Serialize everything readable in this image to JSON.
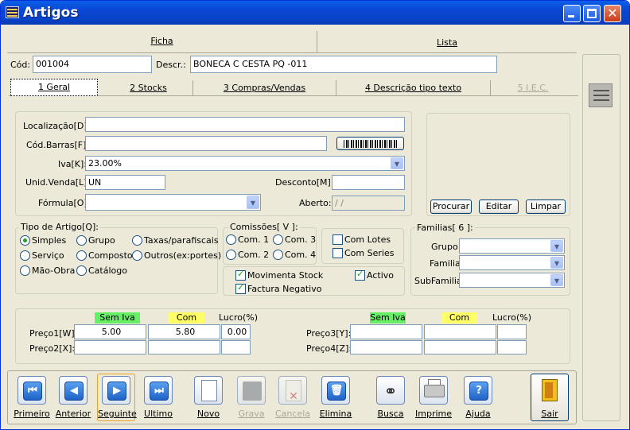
{
  "window": {
    "title": "Artigos"
  },
  "main_tabs": [
    "Ficha",
    "Lista"
  ],
  "header": {
    "cod_label": "Cód:",
    "cod_value": "001004",
    "descr_label": "Descr.:",
    "descr_value": "BONECA C CESTA PQ -011"
  },
  "sub_tabs": [
    "1 Geral",
    "2 Stocks",
    "3 Compras/Vendas",
    "4 Descrição tipo texto",
    "5 I.E.C."
  ],
  "geral": {
    "localizacao_label": "Localização[D]:",
    "localizacao_value": "",
    "codbarras_label": "Cód.Barras[F]:",
    "codbarras_value": "",
    "iva_label": "Iva[K]:",
    "iva_value": "23.00%",
    "unid_label": "Unid.Venda[L]:",
    "unid_value": "UN",
    "desconto_label": "Desconto[M] :",
    "desconto_value": "",
    "formula_label": "Fórmula[O]:",
    "formula_value": "",
    "aberto_label": "Aberto:",
    "aberto_value": " / /"
  },
  "image_buttons": {
    "procurar": "Procurar",
    "editar": "Editar",
    "limpar": "Limpar"
  },
  "tipo_artigo": {
    "label": "Tipo de Artigo[Q]:",
    "options": [
      "Simples",
      "Grupo",
      "Taxas/parafiscais",
      "Serviço",
      "Composto",
      "Outros(ex:portes)",
      "Mão-Obra",
      "Catálogo"
    ],
    "selected": "Simples"
  },
  "comissoes": {
    "label": "Comissões[ V ]:",
    "options": [
      "Com. 1",
      "Com. 3",
      "Com. 2",
      "Com. 4"
    ]
  },
  "lotes": {
    "com_lotes": "Com Lotes",
    "com_series": "Com Series"
  },
  "flags": {
    "movimenta_stock": "Movimenta Stock",
    "activo": "Activo",
    "factura_negativo": "Factura Negativo"
  },
  "familias": {
    "label": "Familias[ 6 ]:",
    "grupo": "Grupo:",
    "familia": "Familia:",
    "subfamilia": "SubFamilia:"
  },
  "precos": {
    "sem_iva": "Sem Iva",
    "com_iva": "Com Iva",
    "lucro": "Lucro(%)",
    "preco1_label": "Preço1[W]:",
    "preco1_sem": "5.00",
    "preco1_com": "5.80",
    "preco1_lucro": "0.00",
    "preco2_label": "Preço2[X]:",
    "preco3_label": "Preço3[Y]:",
    "preco4_label": "Preço4[Z]:"
  },
  "nav": {
    "primeiro": "Primeiro",
    "anterior": "Anterior",
    "seguinte": "Seguinte",
    "ultimo": "Ultimo",
    "novo": "Novo",
    "grava": "Grava",
    "cancela": "Cancela",
    "elimina": "Elimina",
    "busca": "Busca",
    "imprime": "Imprime",
    "ajuda": "Ajuda",
    "sair": "Sair"
  },
  "colors": {
    "title_blue": "#0a46d3",
    "sem_iva_bg": "#66ee66",
    "com_iva_bg": "#ffff66"
  }
}
